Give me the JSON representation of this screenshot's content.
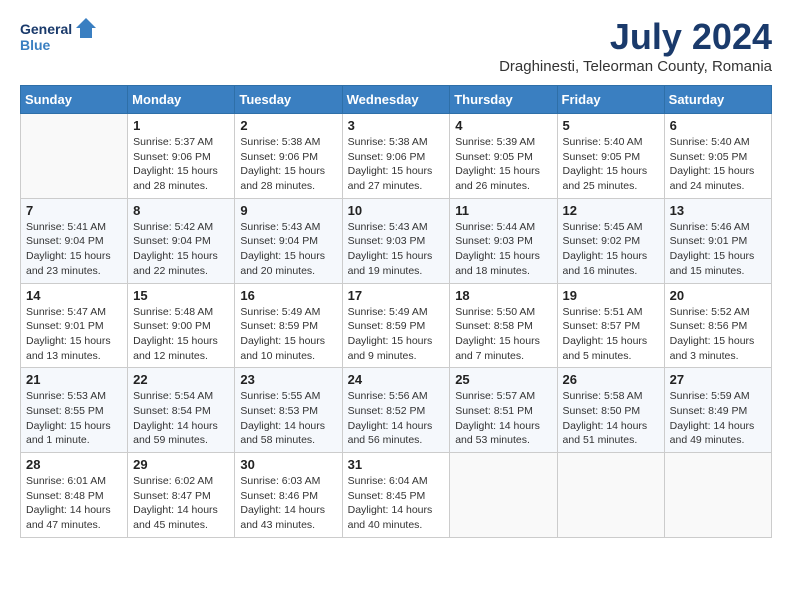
{
  "logo": {
    "line1": "General",
    "line2": "Blue"
  },
  "title": "July 2024",
  "location": "Draghinesti, Teleorman County, Romania",
  "weekdays": [
    "Sunday",
    "Monday",
    "Tuesday",
    "Wednesday",
    "Thursday",
    "Friday",
    "Saturday"
  ],
  "weeks": [
    [
      {
        "day": "",
        "detail": ""
      },
      {
        "day": "1",
        "detail": "Sunrise: 5:37 AM\nSunset: 9:06 PM\nDaylight: 15 hours\nand 28 minutes."
      },
      {
        "day": "2",
        "detail": "Sunrise: 5:38 AM\nSunset: 9:06 PM\nDaylight: 15 hours\nand 28 minutes."
      },
      {
        "day": "3",
        "detail": "Sunrise: 5:38 AM\nSunset: 9:06 PM\nDaylight: 15 hours\nand 27 minutes."
      },
      {
        "day": "4",
        "detail": "Sunrise: 5:39 AM\nSunset: 9:05 PM\nDaylight: 15 hours\nand 26 minutes."
      },
      {
        "day": "5",
        "detail": "Sunrise: 5:40 AM\nSunset: 9:05 PM\nDaylight: 15 hours\nand 25 minutes."
      },
      {
        "day": "6",
        "detail": "Sunrise: 5:40 AM\nSunset: 9:05 PM\nDaylight: 15 hours\nand 24 minutes."
      }
    ],
    [
      {
        "day": "7",
        "detail": "Sunrise: 5:41 AM\nSunset: 9:04 PM\nDaylight: 15 hours\nand 23 minutes."
      },
      {
        "day": "8",
        "detail": "Sunrise: 5:42 AM\nSunset: 9:04 PM\nDaylight: 15 hours\nand 22 minutes."
      },
      {
        "day": "9",
        "detail": "Sunrise: 5:43 AM\nSunset: 9:04 PM\nDaylight: 15 hours\nand 20 minutes."
      },
      {
        "day": "10",
        "detail": "Sunrise: 5:43 AM\nSunset: 9:03 PM\nDaylight: 15 hours\nand 19 minutes."
      },
      {
        "day": "11",
        "detail": "Sunrise: 5:44 AM\nSunset: 9:03 PM\nDaylight: 15 hours\nand 18 minutes."
      },
      {
        "day": "12",
        "detail": "Sunrise: 5:45 AM\nSunset: 9:02 PM\nDaylight: 15 hours\nand 16 minutes."
      },
      {
        "day": "13",
        "detail": "Sunrise: 5:46 AM\nSunset: 9:01 PM\nDaylight: 15 hours\nand 15 minutes."
      }
    ],
    [
      {
        "day": "14",
        "detail": "Sunrise: 5:47 AM\nSunset: 9:01 PM\nDaylight: 15 hours\nand 13 minutes."
      },
      {
        "day": "15",
        "detail": "Sunrise: 5:48 AM\nSunset: 9:00 PM\nDaylight: 15 hours\nand 12 minutes."
      },
      {
        "day": "16",
        "detail": "Sunrise: 5:49 AM\nSunset: 8:59 PM\nDaylight: 15 hours\nand 10 minutes."
      },
      {
        "day": "17",
        "detail": "Sunrise: 5:49 AM\nSunset: 8:59 PM\nDaylight: 15 hours\nand 9 minutes."
      },
      {
        "day": "18",
        "detail": "Sunrise: 5:50 AM\nSunset: 8:58 PM\nDaylight: 15 hours\nand 7 minutes."
      },
      {
        "day": "19",
        "detail": "Sunrise: 5:51 AM\nSunset: 8:57 PM\nDaylight: 15 hours\nand 5 minutes."
      },
      {
        "day": "20",
        "detail": "Sunrise: 5:52 AM\nSunset: 8:56 PM\nDaylight: 15 hours\nand 3 minutes."
      }
    ],
    [
      {
        "day": "21",
        "detail": "Sunrise: 5:53 AM\nSunset: 8:55 PM\nDaylight: 15 hours\nand 1 minute."
      },
      {
        "day": "22",
        "detail": "Sunrise: 5:54 AM\nSunset: 8:54 PM\nDaylight: 14 hours\nand 59 minutes."
      },
      {
        "day": "23",
        "detail": "Sunrise: 5:55 AM\nSunset: 8:53 PM\nDaylight: 14 hours\nand 58 minutes."
      },
      {
        "day": "24",
        "detail": "Sunrise: 5:56 AM\nSunset: 8:52 PM\nDaylight: 14 hours\nand 56 minutes."
      },
      {
        "day": "25",
        "detail": "Sunrise: 5:57 AM\nSunset: 8:51 PM\nDaylight: 14 hours\nand 53 minutes."
      },
      {
        "day": "26",
        "detail": "Sunrise: 5:58 AM\nSunset: 8:50 PM\nDaylight: 14 hours\nand 51 minutes."
      },
      {
        "day": "27",
        "detail": "Sunrise: 5:59 AM\nSunset: 8:49 PM\nDaylight: 14 hours\nand 49 minutes."
      }
    ],
    [
      {
        "day": "28",
        "detail": "Sunrise: 6:01 AM\nSunset: 8:48 PM\nDaylight: 14 hours\nand 47 minutes."
      },
      {
        "day": "29",
        "detail": "Sunrise: 6:02 AM\nSunset: 8:47 PM\nDaylight: 14 hours\nand 45 minutes."
      },
      {
        "day": "30",
        "detail": "Sunrise: 6:03 AM\nSunset: 8:46 PM\nDaylight: 14 hours\nand 43 minutes."
      },
      {
        "day": "31",
        "detail": "Sunrise: 6:04 AM\nSunset: 8:45 PM\nDaylight: 14 hours\nand 40 minutes."
      },
      {
        "day": "",
        "detail": ""
      },
      {
        "day": "",
        "detail": ""
      },
      {
        "day": "",
        "detail": ""
      }
    ]
  ]
}
